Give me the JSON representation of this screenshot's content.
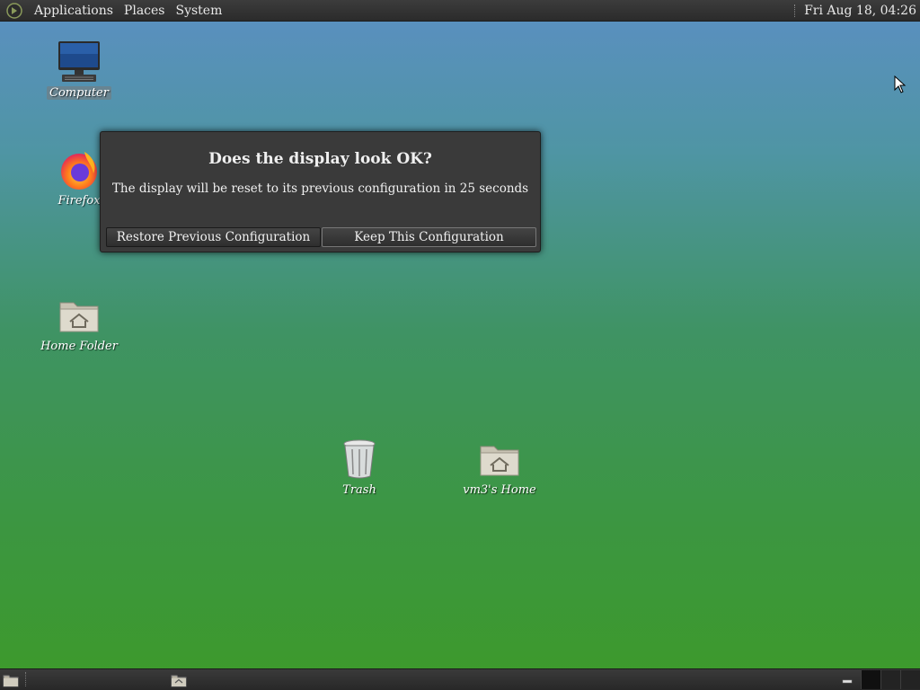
{
  "top_panel": {
    "menus": [
      "Applications",
      "Places",
      "System"
    ],
    "clock": "Fri Aug 18, 04:26"
  },
  "desktop_icons": {
    "computer": "Computer",
    "firefox": "Firefox",
    "home_folder": "Home Folder",
    "trash": "Trash",
    "user_home": "vm3's Home"
  },
  "dialog": {
    "title": "Does the display look OK?",
    "message": "The display will be reset to its previous configuration in 25 seconds",
    "restore_label": "Restore Previous Configuration",
    "keep_label": "Keep This Configuration"
  }
}
